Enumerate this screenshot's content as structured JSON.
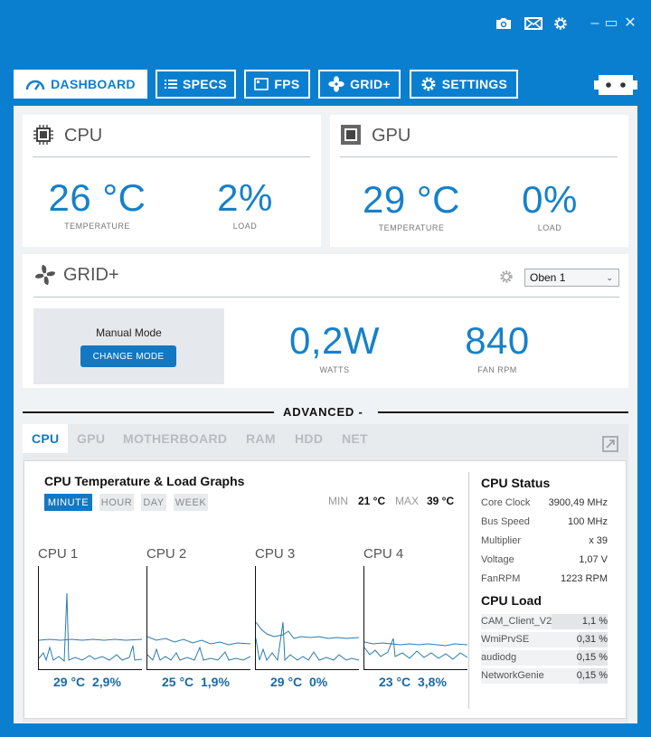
{
  "titlebar": {
    "minimize": "–",
    "restore": "▭",
    "close": "✕"
  },
  "nav": {
    "tabs": [
      {
        "label": "DASHBOARD",
        "icon": "gauge-icon",
        "active": true
      },
      {
        "label": "SPECS",
        "icon": "list-icon"
      },
      {
        "label": "FPS",
        "icon": "monitor-icon"
      },
      {
        "label": "GRID+",
        "icon": "fan-icon"
      },
      {
        "label": "SETTINGS",
        "icon": "gear-icon"
      }
    ]
  },
  "cpu_card": {
    "title": "CPU",
    "temperature": "26 °C",
    "temperature_label": "TEMPERATURE",
    "load": "2%",
    "load_label": "LOAD"
  },
  "gpu_card": {
    "title": "GPU",
    "temperature": "29 °C",
    "temperature_label": "TEMPERATURE",
    "load": "0%",
    "load_label": "LOAD"
  },
  "grid": {
    "title": "GRID+",
    "profile": "Oben 1",
    "mode": "Manual Mode",
    "change_mode": "CHANGE MODE",
    "watts": "0,2W",
    "watts_label": "WATTS",
    "rpm": "840",
    "rpm_label": "FAN RPM"
  },
  "advanced": {
    "label": "ADVANCED -"
  },
  "sub_tabs": [
    "CPU",
    "GPU",
    "MOTHERBOARD",
    "RAM",
    "HDD",
    "NET"
  ],
  "graphs": {
    "title": "CPU Temperature & Load Graphs",
    "ranges": [
      "MINUTE",
      "HOUR",
      "DAY",
      "WEEK"
    ],
    "min_label": "MIN",
    "min_value": "21 °C",
    "max_label": "MAX",
    "max_value": "39 °C",
    "cores": [
      {
        "name": "CPU 1",
        "temp": "29 °C",
        "load": "2,9%"
      },
      {
        "name": "CPU 2",
        "temp": "25 °C",
        "load": "1,9%"
      },
      {
        "name": "CPU 3",
        "temp": "29 °C",
        "load": "0%"
      },
      {
        "name": "CPU 4",
        "temp": "23 °C",
        "load": "3,8%"
      }
    ]
  },
  "cpu_status": {
    "title": "CPU Status",
    "rows": [
      {
        "key": "Core Clock",
        "value": "3900,49 MHz"
      },
      {
        "key": "Bus Speed",
        "value": "100 MHz"
      },
      {
        "key": "Multiplier",
        "value": "x 39"
      },
      {
        "key": "Voltage",
        "value": "1,07 V"
      },
      {
        "key": "FanRPM",
        "value": "1223 RPM"
      }
    ]
  },
  "cpu_load": {
    "title": "CPU Load",
    "rows": [
      {
        "key": "CAM_Client_V2",
        "value": "1,1 %",
        "fraction": 0.011
      },
      {
        "key": "WmiPrvSE",
        "value": "0,31 %",
        "fraction": 0.0031
      },
      {
        "key": "audiodg",
        "value": "0,15 %",
        "fraction": 0.0015
      },
      {
        "key": "NetworkGenie",
        "value": "0,15 %",
        "fraction": 0.0015
      }
    ]
  },
  "colors": {
    "accent": "#0b7fcf",
    "value_blue": "#1581c9",
    "graph_line": "#2b7bb0"
  }
}
